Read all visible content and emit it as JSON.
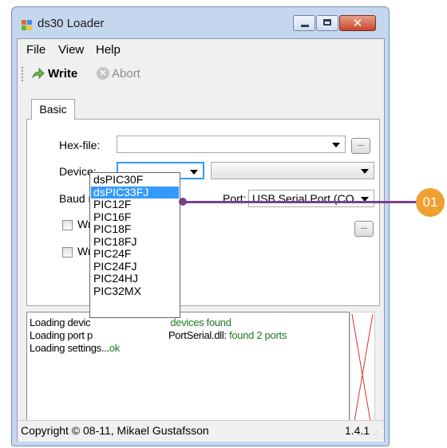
{
  "window": {
    "title": "ds30 Loader",
    "accent": "#c5d7ee"
  },
  "menu": {
    "items": [
      "File",
      "View",
      "Help"
    ]
  },
  "toolbar": {
    "write_label": "Write",
    "abort_label": "Abort",
    "write_icon": "arrow-right-icon",
    "abort_icon": "abort-icon"
  },
  "tabs": {
    "basic": "Basic"
  },
  "form": {
    "hexfile_label": "Hex-file:",
    "hexfile_value": "",
    "device_label": "Device:",
    "device_value": "",
    "device2_value": "",
    "baud_label": "Baud rate:",
    "port_label": "Port:",
    "port_value": "USB Serial Port (CO",
    "write_p_label": "Write p",
    "write_e_label": "Write E",
    "browse_label": "..."
  },
  "dropdown": {
    "options": [
      "dsPIC30F",
      "dsPIC33FJ",
      "PIC12F",
      "PIC16F",
      "PIC18F",
      "PIC18FJ",
      "PIC24F",
      "PIC24FJ",
      "PIC24HJ",
      "PIC32MX"
    ],
    "selected": "dsPIC33FJ",
    "highlight": "#3399ff"
  },
  "log": {
    "line1_a": "Loading devic",
    "line1_b": "devices found",
    "line2_a": "Loading port p",
    "line2_b": "PortSerial.dll: ",
    "line2_c": "found 2 ports",
    "line3_a": "Loading settings...",
    "line3_b": "ok"
  },
  "status": {
    "copyright": "Copyright © 08-11, Mikael Gustafsson",
    "version": "1.4.1"
  },
  "callout": {
    "label": "01",
    "line_color": "#7a3f8c",
    "badge_color": "#f0a030"
  }
}
